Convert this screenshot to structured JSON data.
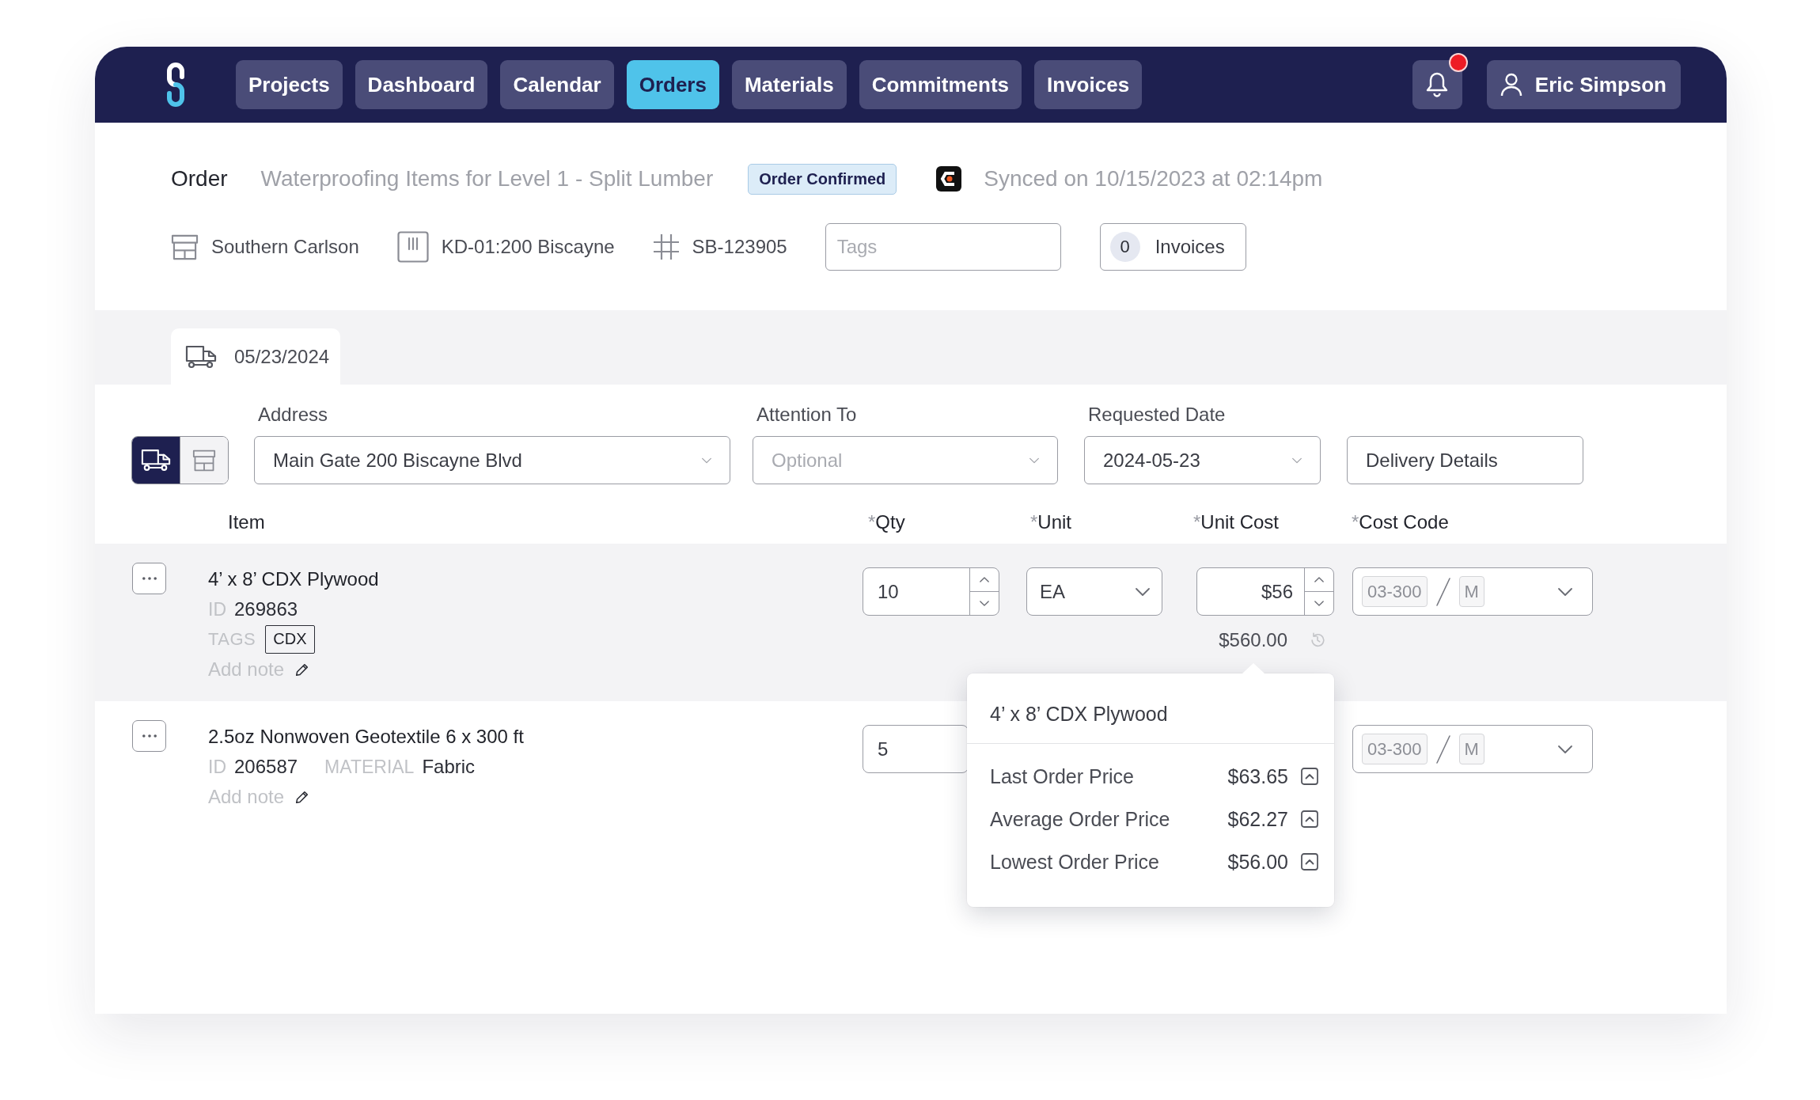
{
  "nav": {
    "items": [
      {
        "label": "Projects",
        "selected": false
      },
      {
        "label": "Dashboard",
        "selected": false
      },
      {
        "label": "Calendar",
        "selected": false
      },
      {
        "label": "Orders",
        "selected": true
      },
      {
        "label": "Materials",
        "selected": false
      },
      {
        "label": "Commitments",
        "selected": false
      },
      {
        "label": "Invoices",
        "selected": false
      }
    ],
    "notifications": {
      "unread": true
    },
    "user": {
      "name": "Eric Simpson"
    }
  },
  "order": {
    "label": "Order",
    "title": "Waterproofing Items for Level 1 - Split Lumber",
    "status": "Order Confirmed",
    "sync_text": "Synced on 10/15/2023 at 02:14pm",
    "meta": [
      {
        "kind": "vendor",
        "text": "Southern Carlson"
      },
      {
        "kind": "job",
        "text": "KD-01:200 Biscayne"
      },
      {
        "kind": "number",
        "text": "SB-123905"
      }
    ],
    "tags_field": {
      "placeholder": "Tags"
    },
    "invoices": {
      "count": "0",
      "label": "Invoices"
    }
  },
  "deliveries": {
    "tabs": [
      {
        "date": "05/23/2024",
        "selected": true
      }
    ],
    "modes": [
      {
        "kind": "delivery",
        "selected": true
      },
      {
        "kind": "pickup",
        "selected": false
      }
    ],
    "fields": [
      {
        "label": "Address",
        "value": "Main Gate 200 Biscayne Blvd"
      },
      {
        "label": "Attention To",
        "placeholder": "Optional"
      },
      {
        "label": "Requested Date",
        "value": "2024-05-23"
      }
    ],
    "details_button": "Delivery Details"
  },
  "items": {
    "columns": [
      {
        "label": "Item"
      },
      {
        "required_mark": "*",
        "label": "Qty"
      },
      {
        "required_mark": "*",
        "label": "Unit"
      },
      {
        "required_mark": "*",
        "label": "Unit Cost"
      },
      {
        "required_mark": "*",
        "label": "Cost Code"
      }
    ],
    "rows": [
      {
        "selected": true,
        "name": "4’ x 8’ CDX Plywood",
        "details": [
          {
            "label": "ID",
            "value": "269863"
          }
        ],
        "tags_label": "TAGS",
        "tags": [
          "CDX"
        ],
        "note_action": "Add note",
        "qty": "10",
        "steppers": true,
        "unit": "EA",
        "unit_cost": "$56",
        "total": "$560.00",
        "cost_code": "03-300",
        "cost_type": "M",
        "price_history": {
          "title": "4’ x 8’ CDX Plywood",
          "prices": [
            {
              "label": "Last Order Price",
              "value": "$63.65"
            },
            {
              "label": "Average Order Price",
              "value": "$62.27"
            },
            {
              "label": "Lowest Order Price",
              "value": "$56.00"
            }
          ]
        }
      },
      {
        "selected": false,
        "name": "2.5oz Nonwoven Geotextile 6 x 300 ft",
        "details": [
          {
            "label": "ID",
            "value": "206587"
          },
          {
            "label": "MATERIAL",
            "value": "Fabric"
          }
        ],
        "note_action": "Add note",
        "qty": "5",
        "steppers": false,
        "cost_code": "03-300",
        "cost_type": "M"
      }
    ]
  }
}
